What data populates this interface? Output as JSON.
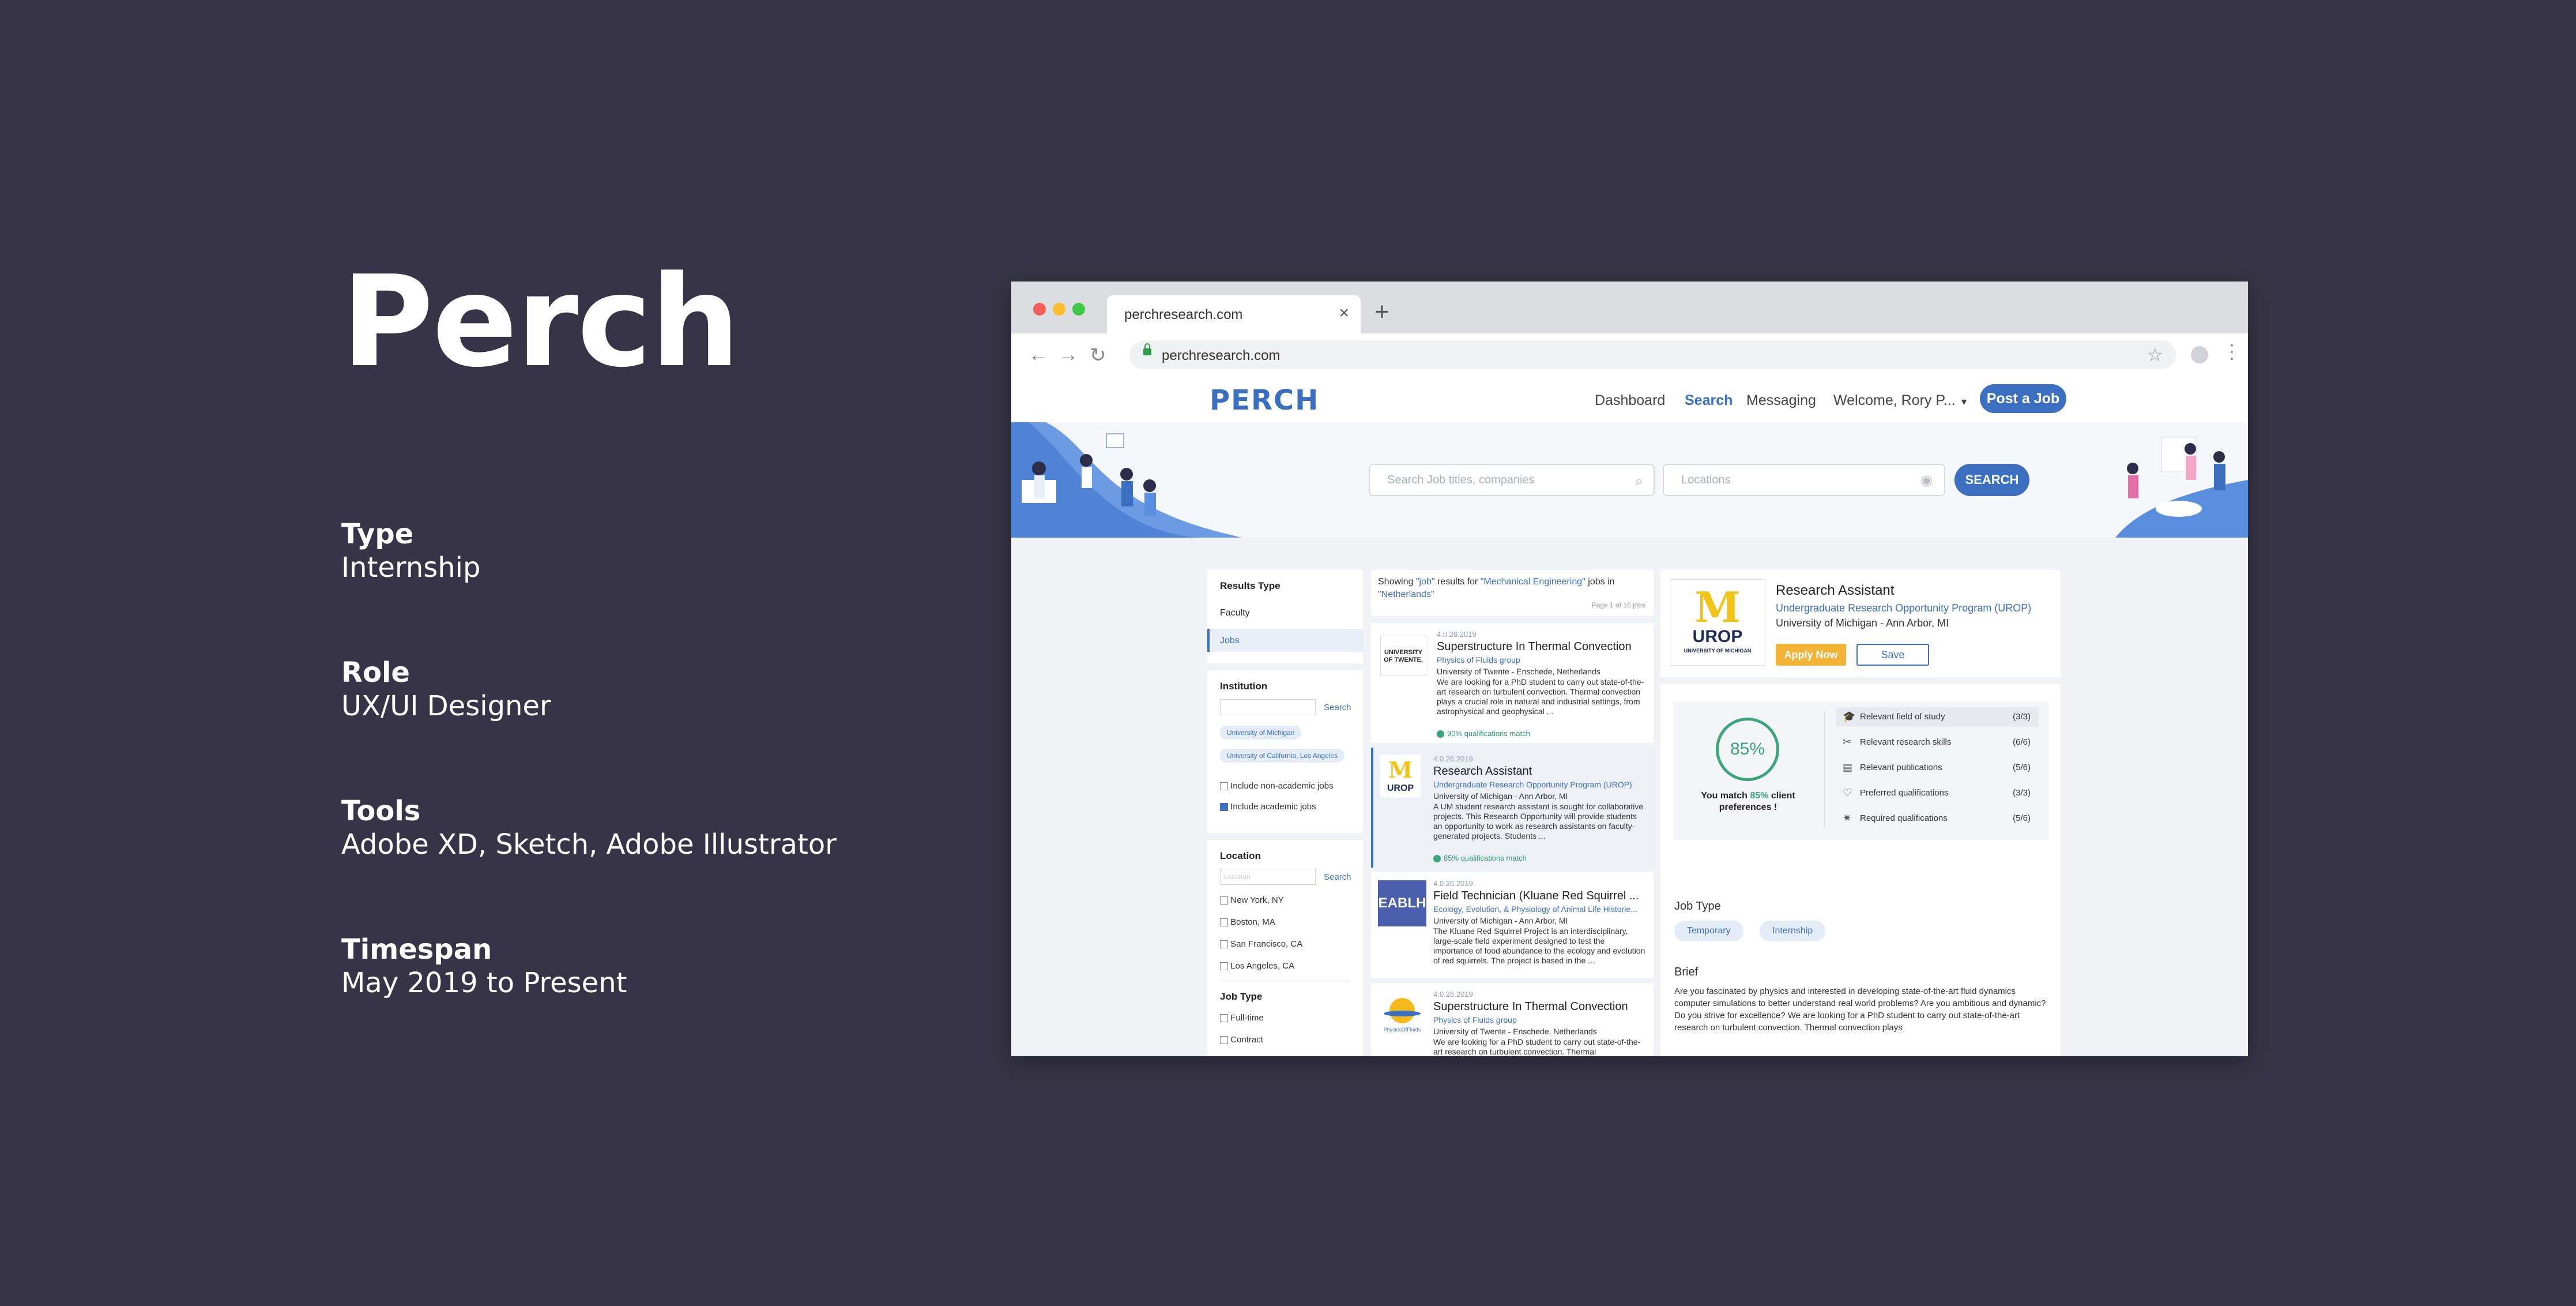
{
  "case_study": {
    "title": "Perch",
    "items": [
      {
        "label": "Type",
        "value": "Internship"
      },
      {
        "label": "Role",
        "value": "UX/UI Designer"
      },
      {
        "label": "Tools",
        "value": "Adobe XD, Sketch, Adobe Illustrator"
      },
      {
        "label": "Timespan",
        "value": "May 2019 to Present"
      }
    ]
  },
  "browser": {
    "tab_title": "perchresearch.com",
    "url": "perchresearch.com"
  },
  "site": {
    "logo": "PERCH",
    "nav": {
      "dashboard": "Dashboard",
      "search": "Search",
      "messaging": "Messaging",
      "welcome": "Welcome, Rory P...",
      "post_job": "Post a Job"
    },
    "search": {
      "job_placeholder": "Search Job titles, companies",
      "location_placeholder": "Locations",
      "button": "SEARCH"
    }
  },
  "filters": {
    "results_type_heading": "Results Type",
    "results_types": [
      "Faculty",
      "Jobs"
    ],
    "institution_heading": "Institution",
    "search_link": "Search",
    "institution_tags": [
      "University of Michigan",
      "University of California, Los Angeles"
    ],
    "include_nonacademic": "Include non-academic jobs",
    "include_academic": "Include academic jobs",
    "location_heading": "Location",
    "location_placeholder": "Location",
    "locations": [
      "New York, NY",
      "Boston, MA",
      "San Francisco, CA",
      "Los Angeles, CA"
    ],
    "job_type_heading": "Job Type",
    "job_types": [
      "Full-time",
      "Contract"
    ]
  },
  "results": {
    "showing_prefix": "Showing",
    "query": "\"job\"",
    "results_for": "results for",
    "field": "\"Mechanical Engineering\"",
    "jobs_in": "jobs in",
    "location": "\"Netherlands\"",
    "page_info": "Page 1 of 16 jobs",
    "cards": [
      {
        "logo": "UNIVERSITY OF TWENTE.",
        "date": "4.0.26.2019",
        "title": "Superstructure In Thermal Convection",
        "group": "Physics of Fluids group",
        "org": "University of Twente - Enschede, Netherlands",
        "body": "We are looking for a PhD student to carry out state-of-the-art research on turbulent convection. Thermal convection plays a crucial role in natural and industrial settings, from astrophysical and geophysical ...",
        "match": "90% qualifications match"
      },
      {
        "logo": "UROP",
        "date": "4.0.26.2019",
        "title": "Research Assistant",
        "group": "Undergraduate Research Opportunity Program (UROP)",
        "org": "University of Michigan - Ann Arbor, MI",
        "body": "A UM student research assistant is sought for collaborative projects. This Research Opportunity will provide students an opportunity to work as research assistants on faculty-generated projects. Students ...",
        "match": "85% qualifications match"
      },
      {
        "logo": "EABLH",
        "date": "4.0.26.2019",
        "title": "Field Technician (Kluane Red Squirrel ...",
        "group": "Ecology, Evolution, & Physiology of Animal Life Historie...",
        "org": "University of Michigan - Ann Arbor, MI",
        "body": "The Kluane Red Squirrel Project is an interdisciplinary, large-scale field experiment designed to test the importance of food abundance to the ecology and evolution of red squirrels. The project is based in the ..."
      },
      {
        "logo": "PhysicsOfFluids",
        "date": "4.0.26.2019",
        "title": "Superstructure In Thermal Convection",
        "group": "Physics of Fluids group",
        "org": "University of Twente - Enschede, Netherlands",
        "body": "We are looking for a PhD student to carry out state-of-the-art research on turbulent convection. Thermal"
      }
    ]
  },
  "detail": {
    "logo_letter": "M",
    "logo_text": "UROP",
    "logo_caption": "UNIVERSITY OF MICHIGAN",
    "title": "Research Assistant",
    "program": "Undergraduate Research Opportunity Program (UROP)",
    "org": "University of Michigan - Ann Arbor, MI",
    "apply": "Apply Now",
    "save": "Save",
    "match_value": "85%",
    "match_prefix": "You match",
    "match_pct": "85%",
    "match_suffix": "client preferences !",
    "qualifications": [
      {
        "icon": "graduation-cap-icon",
        "label": "Relevant field of study",
        "count": "(3/3)"
      },
      {
        "icon": "tools-icon",
        "label": "Relevant research skills",
        "count": "(6/6)"
      },
      {
        "icon": "document-icon",
        "label": "Relevant publications",
        "count": "(5/6)"
      },
      {
        "icon": "heart-icon",
        "label": "Preferred qualifications",
        "count": "(3/3)"
      },
      {
        "icon": "star-icon",
        "label": "Required qualifications",
        "count": "(5/6)"
      }
    ],
    "job_type_heading": "Job Type",
    "job_types": [
      "Temporary",
      "Internship"
    ],
    "brief_heading": "Brief",
    "brief": "Are you fascinated by physics and interested in developing state-of-the-art fluid dynamics computer simulations to better understand real world problems? Are you ambitious and  dynamic? Do you strive for excellence? We are looking for a PhD student to carry out state-of-the-art research on turbulent convection. Thermal convection plays"
  },
  "colors": {
    "background": "#373447",
    "brand_blue": "#3b6fbf",
    "apply_orange": "#f2b235",
    "match_green": "#3aa57a"
  }
}
